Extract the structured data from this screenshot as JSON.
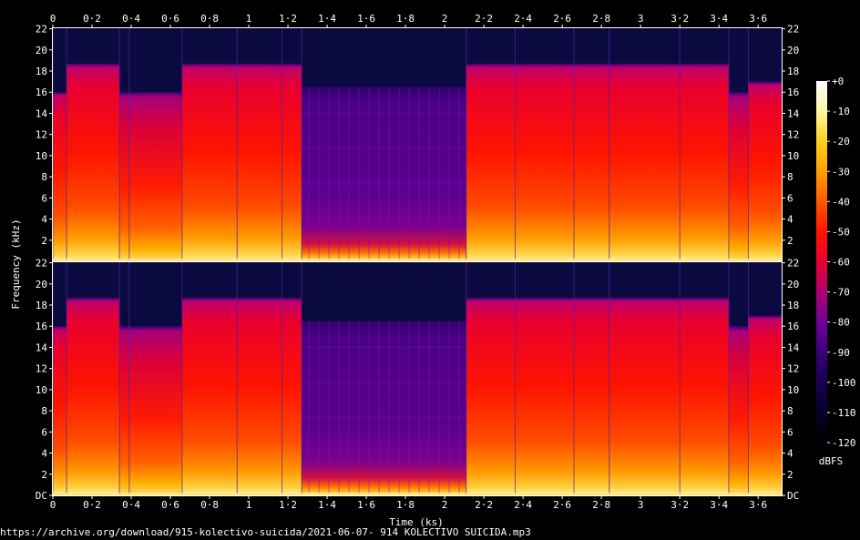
{
  "source_url": "https://archive.org/download/915-kolectivo-suicida/2021-06-07- 914 KOLECTIVO SUICIDA.mp3",
  "chart_data": {
    "type": "heatmap",
    "subtype": "spectrogram",
    "channels": 2,
    "xlabel": "Time (ks)",
    "ylabel": "Frequency (kHz)",
    "xlim": [
      0,
      3.72
    ],
    "ylim": [
      0,
      22.05
    ],
    "x_ticks": [
      {
        "v": 0,
        "label": "0"
      },
      {
        "v": 0.2,
        "label": "0·2"
      },
      {
        "v": 0.4,
        "label": "0·4"
      },
      {
        "v": 0.6,
        "label": "0·6"
      },
      {
        "v": 0.8,
        "label": "0·8"
      },
      {
        "v": 1.0,
        "label": "1"
      },
      {
        "v": 1.2,
        "label": "1·2"
      },
      {
        "v": 1.4,
        "label": "1·4"
      },
      {
        "v": 1.6,
        "label": "1·6"
      },
      {
        "v": 1.8,
        "label": "1·8"
      },
      {
        "v": 2.0,
        "label": "2"
      },
      {
        "v": 2.2,
        "label": "2·2"
      },
      {
        "v": 2.4,
        "label": "2·4"
      },
      {
        "v": 2.6,
        "label": "2·6"
      },
      {
        "v": 2.8,
        "label": "2·8"
      },
      {
        "v": 3.0,
        "label": "3"
      },
      {
        "v": 3.2,
        "label": "3·2"
      },
      {
        "v": 3.4,
        "label": "3·4"
      },
      {
        "v": 3.6,
        "label": "3·6"
      }
    ],
    "y_ticks_upper": [
      {
        "v": 2,
        "label": "2"
      },
      {
        "v": 4,
        "label": "4"
      },
      {
        "v": 6,
        "label": "6"
      },
      {
        "v": 8,
        "label": "8"
      },
      {
        "v": 10,
        "label": "10"
      },
      {
        "v": 12,
        "label": "12"
      },
      {
        "v": 14,
        "label": "14"
      },
      {
        "v": 16,
        "label": "16"
      },
      {
        "v": 18,
        "label": "18"
      },
      {
        "v": 20,
        "label": "20"
      },
      {
        "v": 22,
        "label": "22"
      }
    ],
    "y_ticks_lower": [
      {
        "v": 0,
        "label": "DC"
      },
      {
        "v": 2,
        "label": "2"
      },
      {
        "v": 4,
        "label": "4"
      },
      {
        "v": 6,
        "label": "6"
      },
      {
        "v": 8,
        "label": "8"
      },
      {
        "v": 10,
        "label": "10"
      },
      {
        "v": 12,
        "label": "12"
      },
      {
        "v": 14,
        "label": "14"
      },
      {
        "v": 16,
        "label": "16"
      },
      {
        "v": 18,
        "label": "18"
      },
      {
        "v": 20,
        "label": "20"
      },
      {
        "v": 22,
        "label": "22"
      }
    ],
    "colorbar": {
      "label": "dBFS",
      "range": [
        -120,
        0
      ],
      "ticks": [
        {
          "v": 0,
          "label": "+0"
        },
        {
          "v": -10,
          "label": "-10"
        },
        {
          "v": -20,
          "label": "-20"
        },
        {
          "v": -30,
          "label": "-30"
        },
        {
          "v": -40,
          "label": "-40"
        },
        {
          "v": -50,
          "label": "-50"
        },
        {
          "v": -60,
          "label": "-60"
        },
        {
          "v": -70,
          "label": "-70"
        },
        {
          "v": -80,
          "label": "-80"
        },
        {
          "v": -90,
          "label": "-90"
        },
        {
          "v": -100,
          "label": "-100"
        },
        {
          "v": -110,
          "label": "-110"
        },
        {
          "v": -120,
          "label": "-120"
        }
      ],
      "gradient": [
        {
          "v": 0,
          "color": "#ffffff"
        },
        {
          "v": -10,
          "color": "#fff8a0"
        },
        {
          "v": -20,
          "color": "#ffd020"
        },
        {
          "v": -30,
          "color": "#ffa000"
        },
        {
          "v": -40,
          "color": "#ff5a00"
        },
        {
          "v": -50,
          "color": "#ff1500"
        },
        {
          "v": -60,
          "color": "#e80030"
        },
        {
          "v": -70,
          "color": "#b00070"
        },
        {
          "v": -80,
          "color": "#6e0098"
        },
        {
          "v": -90,
          "color": "#3a0078"
        },
        {
          "v": -100,
          "color": "#180050"
        },
        {
          "v": -110,
          "color": "#060028"
        },
        {
          "v": -120,
          "color": "#000000"
        }
      ]
    },
    "segments": [
      {
        "t0": 0.0,
        "t1": 0.07,
        "cutoff_khz": 16.0,
        "level": "loud"
      },
      {
        "t0": 0.07,
        "t1": 0.34,
        "cutoff_khz": 18.7,
        "level": "loud"
      },
      {
        "t0": 0.34,
        "t1": 0.39,
        "cutoff_khz": 16.0,
        "level": "medium"
      },
      {
        "t0": 0.39,
        "t1": 0.66,
        "cutoff_khz": 16.0,
        "level": "medium"
      },
      {
        "t0": 0.66,
        "t1": 0.94,
        "cutoff_khz": 18.7,
        "level": "loud"
      },
      {
        "t0": 0.94,
        "t1": 1.17,
        "cutoff_khz": 18.7,
        "level": "loud"
      },
      {
        "t0": 1.17,
        "t1": 1.27,
        "cutoff_khz": 18.7,
        "level": "loud"
      },
      {
        "t0": 1.27,
        "t1": 2.11,
        "cutoff_khz": 16.5,
        "level": "quiet"
      },
      {
        "t0": 2.11,
        "t1": 2.36,
        "cutoff_khz": 18.7,
        "level": "loud"
      },
      {
        "t0": 2.36,
        "t1": 2.66,
        "cutoff_khz": 18.7,
        "level": "loud"
      },
      {
        "t0": 2.66,
        "t1": 2.84,
        "cutoff_khz": 18.7,
        "level": "loud"
      },
      {
        "t0": 2.84,
        "t1": 3.2,
        "cutoff_khz": 18.7,
        "level": "loud"
      },
      {
        "t0": 3.2,
        "t1": 3.45,
        "cutoff_khz": 18.7,
        "level": "loud"
      },
      {
        "t0": 3.45,
        "t1": 3.55,
        "cutoff_khz": 16.0,
        "level": "medium"
      },
      {
        "t0": 3.55,
        "t1": 3.72,
        "cutoff_khz": 17.0,
        "level": "loud"
      }
    ],
    "grid": false
  }
}
